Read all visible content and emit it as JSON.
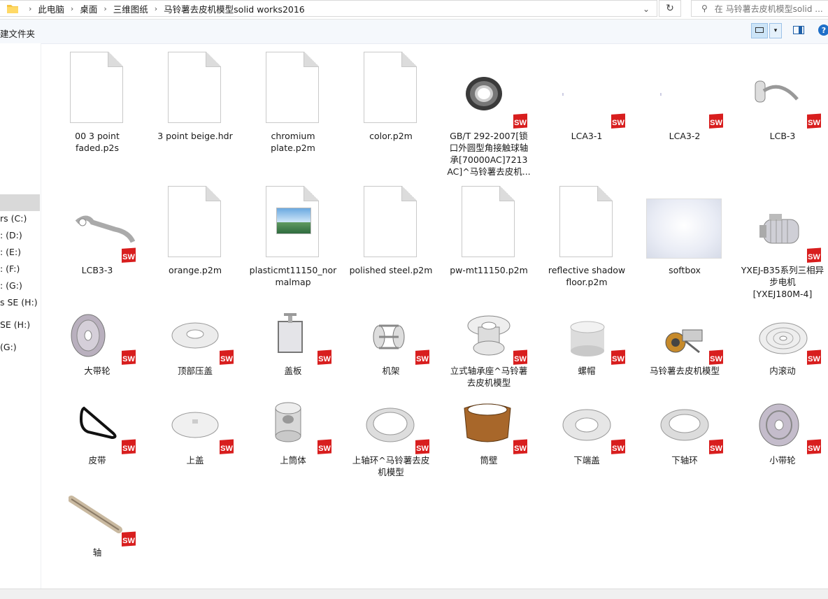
{
  "address": {
    "crumbs": [
      "此电脑",
      "桌面",
      "三维图纸",
      "马铃薯去皮机模型solid works2016"
    ],
    "search_placeholder": "在 马铃薯去皮机模型solid ..."
  },
  "toolbar": {
    "new_folder": "建文件夹",
    "help": "?"
  },
  "nav": {
    "items": [
      "rs (C:)",
      ": (D:)",
      ": (E:)",
      ": (F:)",
      ": (G:)",
      "s SE (H:)",
      " SE (H:)",
      "(G:)"
    ]
  },
  "files": [
    {
      "name": "00 3 point faded.p2s",
      "label1": "00 3 point",
      "label2": "faded.p2s",
      "kind": "doc"
    },
    {
      "name": "3 point beige.hdr",
      "label1": "3 point beige.hdr",
      "kind": "doc"
    },
    {
      "name": "chromium plate.p2m",
      "label1": "chromium",
      "label2": "plate.p2m",
      "kind": "doc"
    },
    {
      "name": "color.p2m",
      "label1": "color.p2m",
      "kind": "doc"
    },
    {
      "name": "GB/T 292-2007",
      "label1": "GB/T 292-2007[锁",
      "label2": "口外圆型角接触球轴",
      "label3": "承[70000AC]7213",
      "label4": "AC]^马铃薯去皮机...",
      "kind": "sw-bearing"
    },
    {
      "name": "LCA3-1",
      "label1": "LCA3-1",
      "kind": "sw-blank"
    },
    {
      "name": "LCA3-2",
      "label1": "LCA3-2",
      "kind": "sw-blank"
    },
    {
      "name": "LCB-3",
      "label1": "LCB-3",
      "kind": "sw-hook"
    },
    {
      "name": "LCB3-3",
      "label1": "LCB3-3",
      "kind": "sw-hook2"
    },
    {
      "name": "orange.p2m",
      "label1": "orange.p2m",
      "kind": "doc"
    },
    {
      "name": "plasticmt11150_normalmap",
      "label1": "plasticmt11150_nor",
      "label2": "malmap",
      "kind": "image"
    },
    {
      "name": "polished steel.p2m",
      "label1": "polished steel.p2m",
      "kind": "doc"
    },
    {
      "name": "pw-mt11150.p2m",
      "label1": "pw-mt11150.p2m",
      "kind": "doc"
    },
    {
      "name": "reflective shadow floor.p2m",
      "label1": "reflective shadow",
      "label2": "floor.p2m",
      "kind": "doc"
    },
    {
      "name": "softbox",
      "label1": "softbox",
      "kind": "softbox"
    },
    {
      "name": "YXEJ-B35",
      "label1": "YXEJ-B35系列三相异",
      "label2": "步电机",
      "label3": "[YXEJ180M-4]",
      "kind": "sw-motor"
    },
    {
      "name": "大带轮",
      "label1": "大带轮",
      "kind": "sw-pulley"
    },
    {
      "name": "顶部压盖",
      "label1": "顶部压盖",
      "kind": "sw-ring"
    },
    {
      "name": "盖板",
      "label1": "盖板",
      "kind": "sw-plate"
    },
    {
      "name": "机架",
      "label1": "机架",
      "kind": "sw-frame"
    },
    {
      "name": "立式轴承座",
      "label1": "立式轴承座^马铃薯",
      "label2": "去皮机模型",
      "kind": "sw-housing"
    },
    {
      "name": "螺帽",
      "label1": "螺帽",
      "kind": "sw-cyl"
    },
    {
      "name": "马铃薯去皮机模型",
      "label1": "马铃薯去皮机模型",
      "kind": "sw-asm"
    },
    {
      "name": "内滚动",
      "label1": "内滚动",
      "kind": "sw-disc"
    },
    {
      "name": "皮带",
      "label1": "皮带",
      "kind": "sw-belt"
    },
    {
      "name": "上盖",
      "label1": "上盖",
      "kind": "sw-lid"
    },
    {
      "name": "上筒体",
      "label1": "上筒体",
      "kind": "sw-can"
    },
    {
      "name": "上轴环",
      "label1": "上轴环^马铃薯去皮",
      "label2": "机模型",
      "kind": "sw-collar"
    },
    {
      "name": "筒壁",
      "label1": "筒壁",
      "kind": "sw-wall"
    },
    {
      "name": "下端盖",
      "label1": "下端盖",
      "kind": "sw-endcap"
    },
    {
      "name": "下轴环",
      "label1": "下轴环",
      "kind": "sw-collar2"
    },
    {
      "name": "小带轮",
      "label1": "小带轮",
      "kind": "sw-spulley"
    },
    {
      "name": "轴",
      "label1": "轴",
      "kind": "sw-shaft"
    }
  ],
  "colors": {
    "selection": "#cce4f7",
    "sw_red": "#d81e1e",
    "nav_selected": "#d9d9d9"
  }
}
